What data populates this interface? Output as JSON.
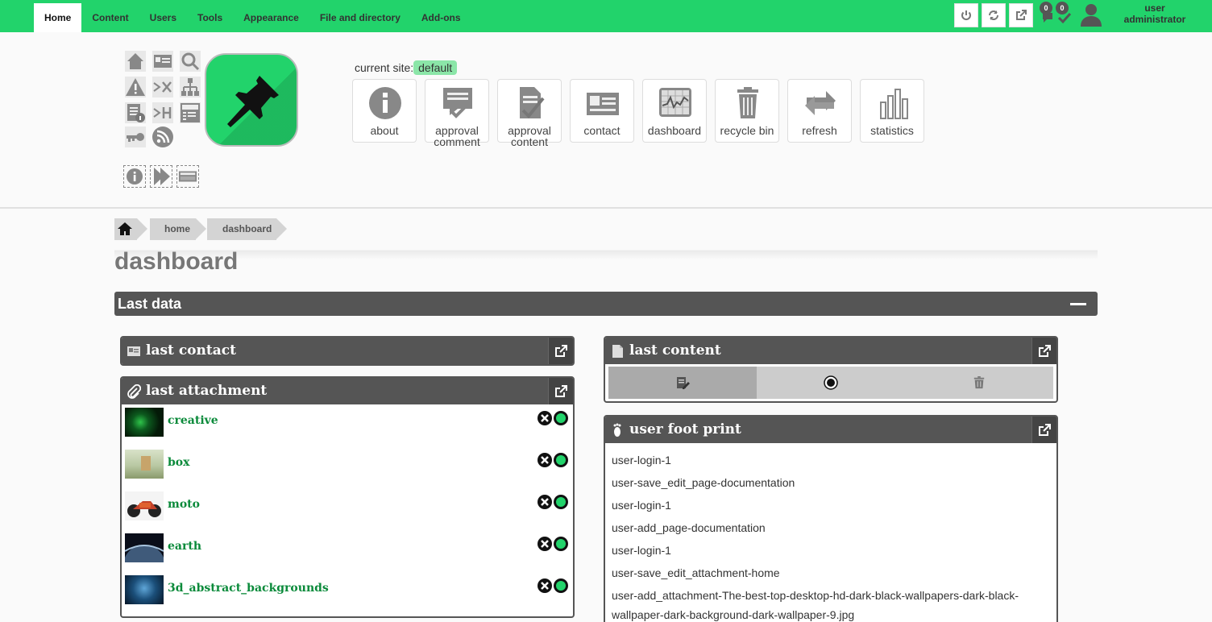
{
  "nav": {
    "tabs": [
      "Home",
      "Content",
      "Users",
      "Tools",
      "Appearance",
      "File and directory",
      "Add-ons"
    ],
    "active": "Home"
  },
  "topbar": {
    "icons": [
      "power-icon",
      "sync-icon",
      "external-link-icon"
    ],
    "comment_count": "0",
    "approval_count": "0",
    "user_line1": "user",
    "user_line2": "administrator"
  },
  "header": {
    "current_site_label": "current site:",
    "current_site_value": "default",
    "quick_buttons": [
      "about",
      "approval comment",
      "approval content",
      "contact",
      "dashboard",
      "recycle bin",
      "refresh",
      "statistics"
    ]
  },
  "breadcrumb": {
    "home": "home",
    "current": "dashboard"
  },
  "page_title": "dashboard",
  "section": {
    "title": "Last data"
  },
  "last_contact": {
    "title": "last contact"
  },
  "last_attachment": {
    "title": "last attachment",
    "items": [
      "creative",
      "box",
      "moto",
      "earth",
      "3d_abstract_backgrounds"
    ]
  },
  "last_content": {
    "title": "last content"
  },
  "user_foot_print": {
    "title": "user foot print",
    "items": [
      "user-login-1",
      "user-save_edit_page-documentation",
      "user-login-1",
      "user-add_page-documentation",
      "user-login-1",
      "user-save_edit_attachment-home",
      "user-add_attachment-The-best-top-desktop-hd-dark-black-wallpapers-dark-black-",
      "wallpaper-dark-background-dark-wallpaper-9.jpg"
    ]
  },
  "colors": {
    "brand_green": "#22d36b",
    "panel_dark": "#555555",
    "link_green": "#0a8a3a"
  }
}
